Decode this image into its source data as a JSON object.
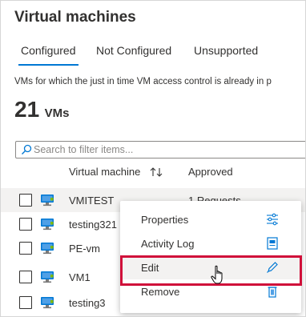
{
  "page": {
    "title": "Virtual machines",
    "description": "VMs for which the just in time VM access control is already in p"
  },
  "tabs": [
    {
      "label": "Configured",
      "active": true
    },
    {
      "label": "Not Configured",
      "active": false
    },
    {
      "label": "Unsupported",
      "active": false
    }
  ],
  "summary": {
    "count": "21",
    "unit": "VMs"
  },
  "search": {
    "placeholder": "Search to filter items..."
  },
  "table": {
    "columns": [
      "Virtual machine",
      "Approved"
    ],
    "rows": [
      {
        "name": "VMITEST",
        "approved": "1 Requests"
      },
      {
        "name": "testing321",
        "approved": ""
      },
      {
        "name": "PE-vm",
        "approved": ""
      },
      {
        "name": "VM1",
        "approved": ""
      },
      {
        "name": "testing3",
        "approved": ""
      }
    ]
  },
  "context_menu": {
    "items": [
      {
        "label": "Properties",
        "icon": "settings-sliders-icon"
      },
      {
        "label": "Activity Log",
        "icon": "activity-log-icon"
      },
      {
        "label": "Edit",
        "icon": "pencil-icon"
      },
      {
        "label": "Remove",
        "icon": "trash-icon"
      }
    ]
  },
  "colors": {
    "accent": "#0078d4",
    "highlight_border": "#d0103a",
    "row_hover": "#f3f2f1"
  }
}
